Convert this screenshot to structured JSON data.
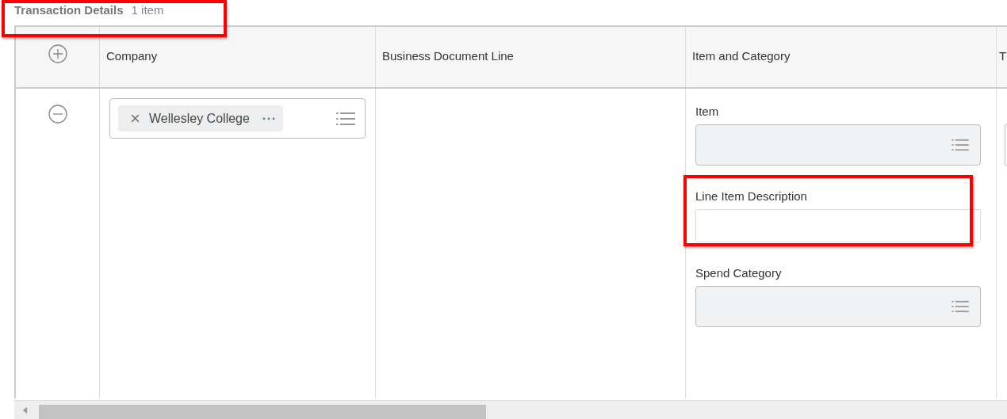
{
  "section": {
    "title": "Transaction Details",
    "count": "1 item",
    "highlighted": true
  },
  "table": {
    "columns": [
      "Company",
      "Business Document Line",
      "Item and Category",
      "T"
    ],
    "rows": [
      {
        "company": {
          "value": "Wellesley College"
        },
        "item_and_category": [
          {
            "kind": "prompt",
            "label": "Item",
            "highlighted": false
          },
          {
            "kind": "text",
            "label": "Line Item Description",
            "highlighted": true
          },
          {
            "kind": "prompt",
            "label": "Spend Category",
            "highlighted": false
          }
        ]
      }
    ]
  }
}
